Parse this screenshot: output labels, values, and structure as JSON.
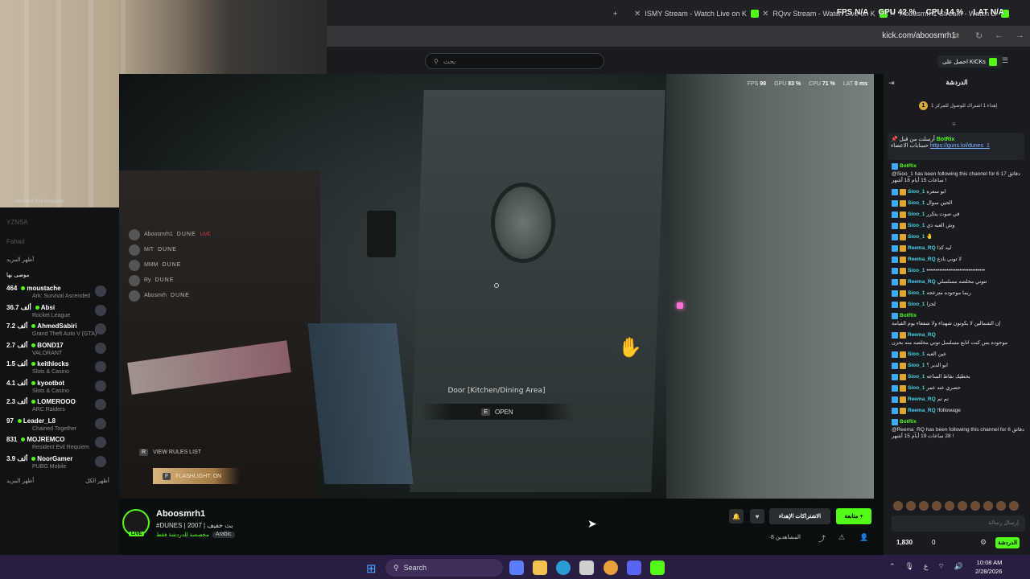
{
  "browser": {
    "tabs": [
      {
        "label": "ISMY Stream - Watch Live on K"
      },
      {
        "label": "RQvv Stream - Watch Live on K"
      },
      {
        "label": "Aboosmrh1 Stream - Watch Li"
      }
    ],
    "new_tab_label": "+",
    "url": "kick.com/aboosmrh1",
    "overlay": {
      "fps": "FPS  N/A",
      "gpu": "GPU  42 %",
      "cpu": "CPU  14 %",
      "lat": "LAT  N/A"
    }
  },
  "header": {
    "search_placeholder": "بحث",
    "get_kicks": "احصل على KICKs"
  },
  "webcam": {
    "game_label": "Resident Evil Requiem"
  },
  "sidebar": {
    "faded": [
      {
        "name": "YZNSA"
      },
      {
        "name": "Fahad"
      }
    ],
    "show_more_top": "أظهر المزيد",
    "recommended_title": "موصى بها",
    "channels": [
      {
        "name": "moustache",
        "viewers": "464",
        "game": "Ark: Survival Ascended"
      },
      {
        "name": "Absi",
        "viewers": "36.7 ألف",
        "game": "Rocket League"
      },
      {
        "name": "AhmedSabiri",
        "viewers": "7.2 ألف",
        "game": "Grand Theft Auto V (GTA)"
      },
      {
        "name": "BOND17",
        "viewers": "2.7 ألف",
        "game": "VALORANT"
      },
      {
        "name": "keithlocks",
        "viewers": "1.5 ألف",
        "game": "Slots & Casino"
      },
      {
        "name": "kyootbot",
        "viewers": "4.1 ألف",
        "game": "Slots & Casino"
      },
      {
        "name": "LOMEROOO",
        "viewers": "2.3 ألف",
        "game": "ARC Raiders"
      },
      {
        "name": "Leader_L8",
        "viewers": "97",
        "game": "Chained Together"
      },
      {
        "name": "MOJREMCO",
        "viewers": "831",
        "game": "Resident Evil Requiem"
      },
      {
        "name": "NoorGamer",
        "viewers": "3.9 ألف",
        "game": "PUBG Mobile"
      }
    ],
    "show_more": "أظهر المزيد",
    "show_all": "أظهر الكل"
  },
  "game": {
    "perf": {
      "fps_label": "FPS",
      "fps": "98",
      "gpu_label": "GPU",
      "gpu": "83 %",
      "cpu_label": "CPU",
      "cpu": "71 %",
      "lat_label": "LAT",
      "lat": "0 ms"
    },
    "door_label": "Door [Kitchen/Dining Area]",
    "open_key": "E",
    "open_label": "OPEN",
    "players": [
      {
        "name": "Aboosmrh1",
        "tag": "DUNE",
        "status": "LIVE"
      },
      {
        "name": "M/T",
        "tag": "DUNE"
      },
      {
        "name": "MMM",
        "tag": "DUNE"
      },
      {
        "name": "Ry",
        "tag": "DUNE"
      },
      {
        "name": "Abosmrh",
        "tag": "DUNE"
      }
    ],
    "rules_key": "R",
    "rules_label": "VIEW RULES LIST",
    "flash_key": "F",
    "flash_label": "FLASHLIGHT: ON"
  },
  "stream": {
    "streamer": "Aboosmrh1",
    "live": "LIVE",
    "title": "#DUNES | 2007 | بث خفيف",
    "category": "مخصصة للدردشة فقط",
    "language": "Arabic",
    "follow": "متابعة +",
    "subscriptions": "الاشتراكات الإهداء",
    "viewers": "8 المشاهدين"
  },
  "chat": {
    "title": "الدردشة",
    "leaderboard_rank": "1",
    "leaderboard_text": "إهداء 1 اشتراك للوصول للمركز 1",
    "pinned": {
      "prefix": "أرسلت من قبل",
      "user": "BotRix",
      "text": "حسابات الاعضاء",
      "link": "https://guns.lol/dunes_1"
    },
    "messages": [
      {
        "user": "BotRix",
        "text": "@Sioo_1 has been following this channel for 6 دقائق 17 ساعات 15 أيام 18 أشهر !",
        "bot": true
      },
      {
        "user": "Sioo_1",
        "text": "ابو سعره"
      },
      {
        "user": "Sioo_1",
        "text": "الحين سوال"
      },
      {
        "user": "Sioo_1",
        "text": "في صوت يتكرر"
      },
      {
        "user": "Sioo_1",
        "text": "وش العبه ذي"
      },
      {
        "user": "Sioo_1",
        "text": "🤚"
      },
      {
        "user": "Reema_RQ",
        "text": "ليه كذا"
      },
      {
        "user": "Reema_RQ",
        "text": "لا توني بادع"
      },
      {
        "user": "Sioo_1",
        "text": "••••••••••••••••••••••••••••••••"
      },
      {
        "user": "Reema_RQ",
        "text": "تتوني مخلصه مسلسلي"
      },
      {
        "user": "Sioo_1",
        "text": "ربما موجوده متزعجه"
      },
      {
        "user": "Sioo_1",
        "text": "لحزا"
      },
      {
        "user": "BotRix",
        "text": "إن الشمالين لا يكونون شهداء ولا شفعاء يوم القيامة",
        "bot": true
      },
      {
        "user": "Reema_RQ",
        "text": "موجوده بس كنت اتابع مسلسل توني مخلصه منه بحزن"
      },
      {
        "user": "Sioo_1",
        "text": "عين العبه"
      },
      {
        "user": "Sioo_1",
        "text": "ابو الدبر ؟"
      },
      {
        "user": "Sioo_1",
        "text": "بحطيك نقاط الساعه"
      },
      {
        "user": "Sioo_1",
        "text": "حصري عند عمر"
      },
      {
        "user": "Reema_RQ",
        "text": "تم تم"
      },
      {
        "user": "Reema_RQ",
        "text": "!followage"
      },
      {
        "user": "BotRix",
        "text": "@Reema_RQ has been following this channel for 6 دقائق 28 ساعات 19 أيام 15 أشهر !",
        "bot": true
      }
    ],
    "input_placeholder": "إرسال رسالة",
    "kicks": "1,830",
    "zero": "0",
    "send": "الدردشة"
  },
  "taskbar": {
    "search": "Search",
    "time": "10:08 AM",
    "date": "2/28/2026"
  }
}
